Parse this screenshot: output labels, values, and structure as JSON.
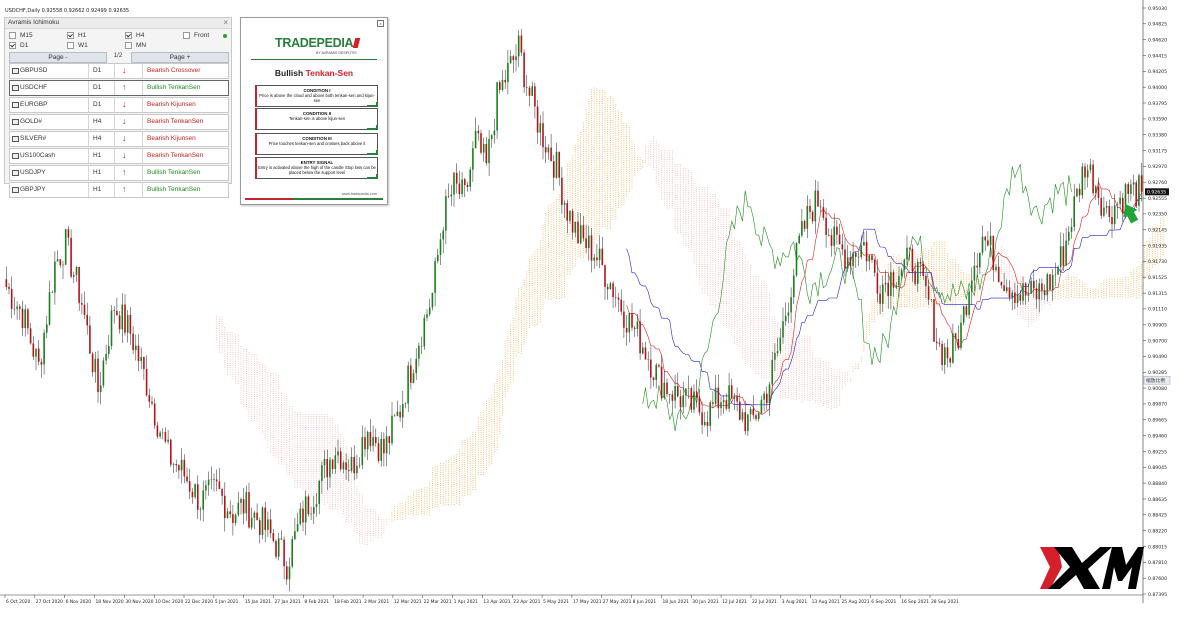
{
  "window": {
    "symbol_line": "USDCHF,Daily  0.92558 0.92662 0.92499 0.92635"
  },
  "panel": {
    "title": "Avramis Ichimoku",
    "close_glyph": "×",
    "timeframes": [
      {
        "label": "M15",
        "checked": false
      },
      {
        "label": "H1",
        "checked": true
      },
      {
        "label": "H4",
        "checked": true
      },
      {
        "label": "Front",
        "checked": false
      },
      {
        "label": "D1",
        "checked": true
      },
      {
        "label": "W1",
        "checked": false
      },
      {
        "label": "MN",
        "checked": false
      }
    ],
    "page_prev": "Page -",
    "page_num": "1/2",
    "page_next": "Page +",
    "rows": [
      {
        "symbol": "GBPUSD",
        "tf": "D1",
        "dir": "down",
        "signal": "Bearish Crossover"
      },
      {
        "symbol": "USDCHF",
        "tf": "D1",
        "dir": "up",
        "signal": "Bullish TenkanSen"
      },
      {
        "symbol": "EURGBP",
        "tf": "D1",
        "dir": "down",
        "signal": "Bearish Kijunsen"
      },
      {
        "symbol": "GOLD#",
        "tf": "H4",
        "dir": "down",
        "signal": "Bearish TenkanSen"
      },
      {
        "symbol": "SILVER#",
        "tf": "H4",
        "dir": "down",
        "signal": "Bearish Kijunsen"
      },
      {
        "symbol": "US100Cash",
        "tf": "H1",
        "dir": "down",
        "signal": "Bearish TenkanSen"
      },
      {
        "symbol": "USDJPY",
        "tf": "H1",
        "dir": "up",
        "signal": "Bullish TenkanSen"
      },
      {
        "symbol": "GBPJPY",
        "tf": "H1",
        "dir": "up",
        "signal": "Bullish TenkanSen"
      }
    ]
  },
  "card": {
    "close_glyph": "x",
    "logo": "TRADEPEDIA",
    "logo_sub": "BY AVRAMIS DESPOTIS",
    "heading_black": "Bullish",
    "heading_red": "Tenkan-Sen",
    "conditions": [
      {
        "title": "CONDITION I",
        "text": "Price is above the cloud and above both tenkan-sen and kijun-sen"
      },
      {
        "title": "CONDITION II",
        "text": "Tenkan-sen is above kijun-sen"
      },
      {
        "title": "CONDITION III",
        "text": "Price touches tenkan-sen and crosses back above it"
      },
      {
        "title": "ENTRY SIGNAL",
        "text": "Entry is activated above the high of the candle Stop loss can be placed below the support level"
      }
    ],
    "url": "www.tradepedia.com"
  },
  "logo": {
    "text": "XM"
  },
  "colors": {
    "bull": "#1e7d1e",
    "bear": "#b3141a",
    "tenkan": "#e02020",
    "kijun": "#2424d0",
    "chikou": "#1f8f1f",
    "cloud_bull": "#f2a23a",
    "cloud_bear": "#f0a8a8",
    "signal_arrow": "#1fa53a"
  },
  "chart_data": {
    "type": "candlestick",
    "symbol": "USDCHF",
    "timeframe": "Daily",
    "ylim": [
      0.87395,
      0.9503
    ],
    "y_ticks": [
      "0.95030",
      "0.94825",
      "0.94620",
      "0.94415",
      "0.94205",
      "0.94000",
      "0.93795",
      "0.93590",
      "0.93380",
      "0.93175",
      "0.92970",
      "0.92760",
      "0.92555",
      "0.92350",
      "0.92145",
      "0.91935",
      "0.91730",
      "0.91525",
      "0.91315",
      "0.91110",
      "0.90905",
      "0.90700",
      "0.90490",
      "0.90285",
      "0.90080",
      "0.89870",
      "0.89665",
      "0.89460",
      "0.89255",
      "0.89045",
      "0.88840",
      "0.88635",
      "0.88425",
      "0.88220",
      "0.88015",
      "0.87810",
      "0.87600",
      "0.87395"
    ],
    "current_price": "0.92635",
    "scale_badge": "缩放比例",
    "x_ticks": [
      "6 Oct 2020",
      "27 Oct 2020",
      "6 Nov 2020",
      "18 Nov 2020",
      "30 Nov 2020",
      "10 Dec 2020",
      "22 Dec 2020",
      "5 Jan 2021",
      "15 Jan 2021",
      "27 Jan 2021",
      "8 Feb 2021",
      "18 Feb 2021",
      "2 Mar 2021",
      "12 Mar 2021",
      "22 Mar 2021",
      "1 Apr 2021",
      "13 Apr 2021",
      "23 Apr 2021",
      "5 May 2021",
      "17 May 2021",
      "27 May 2021",
      "8 Jun 2021",
      "18 Jun 2021",
      "30 Jun 2021",
      "12 Jul 2021",
      "22 Jul 2021",
      "3 Aug 2021",
      "13 Aug 2021",
      "25 Aug 2021",
      "6 Sep 2021",
      "16 Sep 2021",
      "28 Sep 2021"
    ],
    "close_path": [
      [
        0,
        0.914
      ],
      [
        6,
        0.9105
      ],
      [
        12,
        0.9035
      ],
      [
        18,
        0.917
      ],
      [
        22,
        0.9195
      ],
      [
        28,
        0.912
      ],
      [
        34,
        0.9005
      ],
      [
        40,
        0.9115
      ],
      [
        46,
        0.908
      ],
      [
        52,
        0.9015
      ],
      [
        56,
        0.8965
      ],
      [
        60,
        0.892
      ],
      [
        66,
        0.8895
      ],
      [
        72,
        0.886
      ],
      [
        78,
        0.8875
      ],
      [
        84,
        0.8845
      ],
      [
        88,
        0.8855
      ],
      [
        94,
        0.8835
      ],
      [
        100,
        0.8805
      ],
      [
        104,
        0.878
      ],
      [
        110,
        0.8845
      ],
      [
        116,
        0.8885
      ],
      [
        122,
        0.893
      ],
      [
        128,
        0.8905
      ],
      [
        134,
        0.8955
      ],
      [
        140,
        0.8925
      ],
      [
        146,
        0.898
      ],
      [
        152,
        0.906
      ],
      [
        158,
        0.913
      ],
      [
        162,
        0.923
      ],
      [
        166,
        0.927
      ],
      [
        170,
        0.9255
      ],
      [
        174,
        0.933
      ],
      [
        178,
        0.9295
      ],
      [
        182,
        0.9385
      ],
      [
        186,
        0.942
      ],
      [
        190,
        0.945
      ],
      [
        194,
        0.939
      ],
      [
        198,
        0.9345
      ],
      [
        204,
        0.9295
      ],
      [
        208,
        0.924
      ],
      [
        212,
        0.9205
      ],
      [
        218,
        0.9185
      ],
      [
        224,
        0.9145
      ],
      [
        230,
        0.91
      ],
      [
        236,
        0.9065
      ],
      [
        242,
        0.902
      ],
      [
        248,
        0.9
      ],
      [
        254,
        0.8985
      ],
      [
        260,
        0.8975
      ],
      [
        266,
        0.9
      ],
      [
        270,
        0.8985
      ],
      [
        276,
        0.896
      ],
      [
        282,
        0.9005
      ],
      [
        286,
        0.9055
      ],
      [
        290,
        0.9125
      ],
      [
        294,
        0.9195
      ],
      [
        298,
        0.924
      ],
      [
        302,
        0.9255
      ],
      [
        306,
        0.92
      ],
      [
        312,
        0.918
      ],
      [
        318,
        0.9195
      ],
      [
        324,
        0.914
      ],
      [
        330,
        0.916
      ],
      [
        336,
        0.9175
      ],
      [
        342,
        0.912
      ],
      [
        346,
        0.906
      ],
      [
        350,
        0.905
      ],
      [
        354,
        0.9085
      ],
      [
        358,
        0.9165
      ],
      [
        362,
        0.9205
      ],
      [
        366,
        0.918
      ],
      [
        370,
        0.915
      ],
      [
        376,
        0.913
      ],
      [
        382,
        0.913
      ],
      [
        388,
        0.915
      ],
      [
        392,
        0.9185
      ],
      [
        396,
        0.9245
      ],
      [
        400,
        0.93
      ],
      [
        404,
        0.9275
      ],
      [
        408,
        0.9235
      ],
      [
        412,
        0.925
      ],
      [
        416,
        0.9264
      ]
    ]
  }
}
